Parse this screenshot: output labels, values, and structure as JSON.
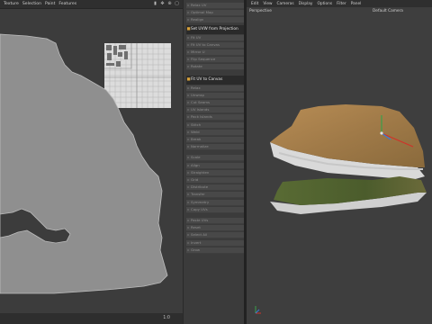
{
  "uv_editor": {
    "menu": [
      "Texture",
      "Selection",
      "Paint",
      "Features"
    ],
    "zoom_label": "1:0"
  },
  "commands": [
    {
      "label": "Relax UV",
      "icon": "relax-icon"
    },
    {
      "label": "Optimal Map",
      "icon": "map-icon"
    },
    {
      "label": "Realign",
      "icon": "realign-icon"
    },
    {
      "label": "Set UVW from Projection",
      "icon": "projection-icon",
      "big": true
    },
    {
      "label": "Fit UV",
      "icon": "fit-icon"
    },
    {
      "label": "Fit UV to Canvas",
      "icon": "canvas-icon"
    },
    {
      "label": "Mirror U",
      "icon": "mirror-icon"
    },
    {
      "label": "Flip Sequence",
      "icon": "flip-icon"
    },
    {
      "label": "Rotate",
      "icon": "rotate-icon"
    },
    {
      "label": "Fit UV to Canvas",
      "icon": "fit-canvas-icon",
      "big": true
    },
    {
      "label": "Relax",
      "icon": "relax-icon"
    },
    {
      "label": "Unwrap",
      "icon": "unwrap-icon"
    },
    {
      "label": "Cut Seams",
      "icon": "seams-icon"
    },
    {
      "label": "UV Islands",
      "icon": "islands-icon"
    },
    {
      "label": "Pack Islands",
      "icon": "pack-icon"
    },
    {
      "label": "Stitch",
      "icon": "stitch-icon"
    },
    {
      "label": "Weld",
      "icon": "weld-icon"
    },
    {
      "label": "Break",
      "icon": "break-icon"
    },
    {
      "label": "Normalize",
      "icon": "normalize-icon"
    },
    {
      "label": "Scale",
      "icon": "scale-icon"
    },
    {
      "label": "Align",
      "icon": "align-icon"
    },
    {
      "label": "Straighten",
      "icon": "straighten-icon"
    },
    {
      "label": "Grid",
      "icon": "grid-icon"
    },
    {
      "label": "Distribute",
      "icon": "distribute-icon"
    },
    {
      "label": "Transfer",
      "icon": "transfer-icon"
    },
    {
      "label": "Symmetry",
      "icon": "symmetry-icon"
    },
    {
      "label": "Copy UVs",
      "icon": "copy-icon"
    },
    {
      "label": "Paste UVs",
      "icon": "paste-icon"
    },
    {
      "label": "Reset",
      "icon": "reset-icon"
    },
    {
      "label": "Select All",
      "icon": "select-icon"
    },
    {
      "label": "Invert",
      "icon": "invert-icon"
    },
    {
      "label": "Grow",
      "icon": "grow-icon"
    }
  ],
  "viewport": {
    "menu": [
      "Edit",
      "View",
      "Cameras",
      "Display",
      "Options",
      "Filter",
      "Panel"
    ],
    "perspective_label": "Perspective",
    "camera_label": "Default Camera"
  },
  "colors": {
    "accent": "#d8a23a",
    "background": "#2b2b2b",
    "uv_island": "#8c8c8c"
  }
}
